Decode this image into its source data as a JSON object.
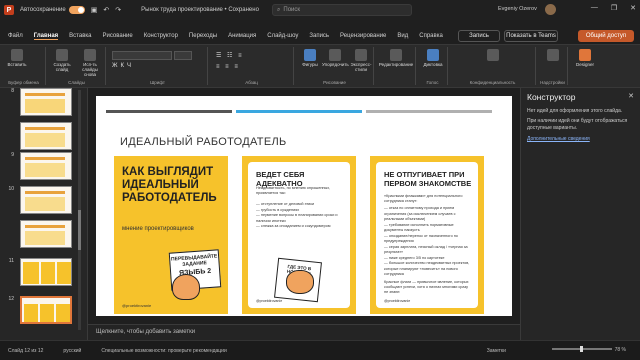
{
  "titlebar": {
    "app_icon": "P",
    "autosave_label": "Автосохранение",
    "document_title": "Рынок труда проектирование • Сохранено",
    "search_placeholder": "Поиск",
    "user_name": "Evgeniy Ozerov",
    "window_buttons": [
      "—",
      "❐",
      "✕"
    ]
  },
  "tabs": [
    "Файл",
    "Главная",
    "Вставка",
    "Рисование",
    "Конструктор",
    "Переходы",
    "Анимация",
    "Слайд-шоу",
    "Запись",
    "Рецензирование",
    "Вид",
    "Справка"
  ],
  "active_tab": "Главная",
  "buttons": {
    "record": "Запись",
    "teams": "Показать в Teams",
    "share": "Общий доступ"
  },
  "ribbon": {
    "groups": [
      "Буфер обмена",
      "Слайды",
      "Шрифт",
      "Абзац",
      "Рисование",
      "Редактирование",
      "Голос",
      "Конфиденциальность",
      "Надстройки"
    ],
    "paste": "Вставить",
    "new_slide": "Создать слайд",
    "reuse_slides": "Исп-ть слайды снова",
    "shapes": "Фигуры",
    "arrange": "Упорядочить",
    "styles": "Экспресс-стили",
    "editing": "Редактирование",
    "dictate": "Диктовка",
    "sensitivity": "Конфиденциальность",
    "addins": "Надстройки",
    "designer": "Designer"
  },
  "slides": {
    "numbers": [
      "8",
      "9",
      "10",
      "11",
      "12"
    ],
    "selected": "12"
  },
  "slide": {
    "title": "ИДЕАЛЬНЫЙ РАБОТОДАТЕЛЬ",
    "card1": {
      "title": "КАК ВЫГЛЯДИТ ИДЕАЛЬНЫЙ РАБОТОДАТЕЛЬ",
      "subtitle": "мнение проектировщиков",
      "sticker_line1": "ПЕРЕВЫДАВАЙТЕ ЗАДАНИЕ",
      "sticker_line2": "ЯЗЫБЬ 2",
      "footer": "@proektirovanie"
    },
    "card2": {
      "title": "ВЕДЕТ СЕБЯ АДЕКВАТНО",
      "intro": "Неадекватность, по мнению опрошенных, проявляется так:",
      "bullets": [
        "отступление от деловой этики",
        "грубость в суждениях",
        "неумение вопросы в планировании сроки и наличии ипотеки",
        "слежка за опозданием и сокундомером"
      ],
      "sticker": "ГДЕ ЭТО В НОРМАХ?!",
      "footer": "@proektirovanie"
    },
    "card3": {
      "title": "НЕ ОТПУГИВАЕТ ПРИ ПЕРВОМ ЗНАКОМСТВЕ",
      "intro": "«Красными флажками» для потенциального сотрудника станут:",
      "bullets": [
        "отказ по оплатному прохода и прием ограничения (за исключением случаев с реальными объектами)",
        "требование исполнить нормативные документы наизусть",
        "опоздание/перенос от назначенного по предупреждения",
        "серая зарплата, неясный оклад / «черная за результат»",
        "ниже среднего 3/5 по картотеке",
        "большое количество неадекватных проектов, которые планируют «повесить» на нового сотрудника"
      ],
      "outro": "Красные флаги — привычное явление, которых сообщают успехи, хотя о нихнах многими сразу не знают.",
      "footer": "@proektirovanie"
    }
  },
  "notes_placeholder": "Щелкните, чтобы добавить заметки",
  "panel": {
    "title": "Конструктор",
    "line1": "Нет идей для оформления этого слайда.",
    "line2": "При наличии идей они будут отображаться доступные варианты.",
    "link": "Дополнительные сведения"
  },
  "statusbar": {
    "slide_count": "Слайд 12 из 12",
    "language": "русский",
    "accessibility": "Специальные возможности: проверьте рекомендации",
    "notes": "Заметки",
    "zoom": "78 %"
  },
  "colors": {
    "accent": "#e0763a",
    "card_yellow": "#f6c22b",
    "line_dark": "#555555",
    "line_blue": "#3aa7e0",
    "line_grey": "#b0b0b0"
  }
}
